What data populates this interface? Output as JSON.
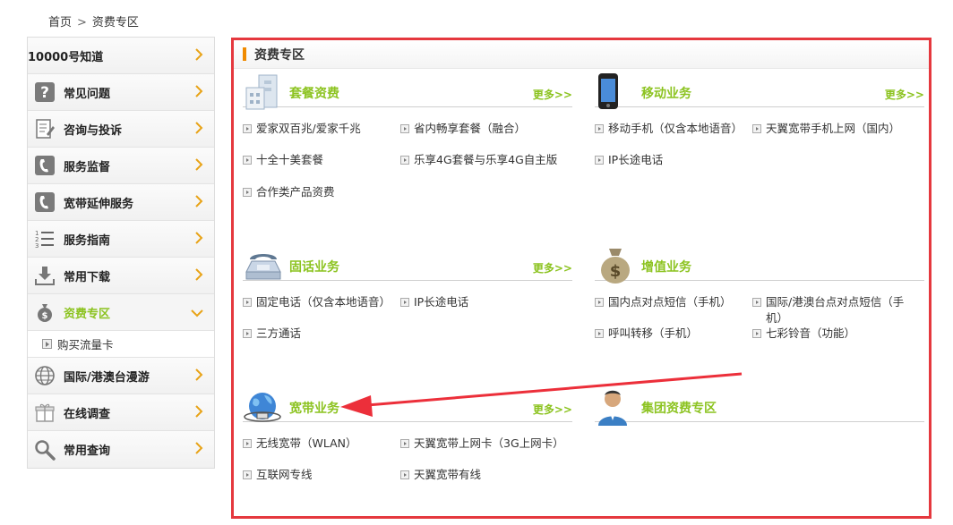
{
  "breadcrumb": {
    "home": "首页",
    "separator": ">",
    "current": "资费专区"
  },
  "sidebar": {
    "items": [
      {
        "label": "10000号知道",
        "icon": "none"
      },
      {
        "label": "常见问题",
        "icon": "question-icon"
      },
      {
        "label": "咨询与投诉",
        "icon": "note-edit-icon"
      },
      {
        "label": "服务监督",
        "icon": "phone-icon"
      },
      {
        "label": "宽带延伸服务",
        "icon": "phone-icon"
      },
      {
        "label": "服务指南",
        "icon": "list-icon"
      },
      {
        "label": "常用下载",
        "icon": "download-icon"
      },
      {
        "label": "资费专区",
        "icon": "money-bag-icon",
        "active": true
      },
      {
        "label": "国际/港澳台漫游",
        "icon": "globe-icon"
      },
      {
        "label": "在线调查",
        "icon": "gift-icon"
      },
      {
        "label": "常用查询",
        "icon": "search-icon"
      }
    ],
    "sub_item": "购买流量卡"
  },
  "main": {
    "title": "资费专区",
    "more_label": "更多>>",
    "sections": {
      "package": {
        "title": "套餐资费",
        "icon": "building-icon",
        "links": [
          "爱家双百兆/爱家千兆",
          "省内畅享套餐（融合）",
          "十全十美套餐",
          "乐享4G套餐与乐享4G自主版",
          "合作类产品资费"
        ]
      },
      "mobile": {
        "title": "移动业务",
        "icon": "mobile-phone-icon",
        "links": [
          "移动手机（仅含本地语音）",
          "天翼宽带手机上网（国内）",
          "IP长途电话"
        ]
      },
      "landline": {
        "title": "固话业务",
        "icon": "desk-phone-icon",
        "links": [
          "固定电话（仅含本地语音）",
          "IP长途电话",
          "三方通话"
        ]
      },
      "value_added": {
        "title": "增值业务",
        "icon": "money-bag-icon",
        "links": [
          "国内点对点短信（手机）",
          "国际/港澳台点对点短信（手机）",
          "呼叫转移（手机）",
          "七彩铃音（功能）"
        ]
      },
      "broadband": {
        "title": "宽带业务",
        "icon": "globe-network-icon",
        "links": [
          "无线宽带（WLAN）",
          "天翼宽带上网卡（3G上网卡）",
          "互联网专线",
          "天翼宽带有线"
        ]
      },
      "group": {
        "title": "集团资费专区",
        "icon": "person-icon"
      }
    }
  },
  "colors": {
    "accent_green": "#8cc320",
    "highlight_red": "#e5383e",
    "header_bar": "#f08a00"
  }
}
